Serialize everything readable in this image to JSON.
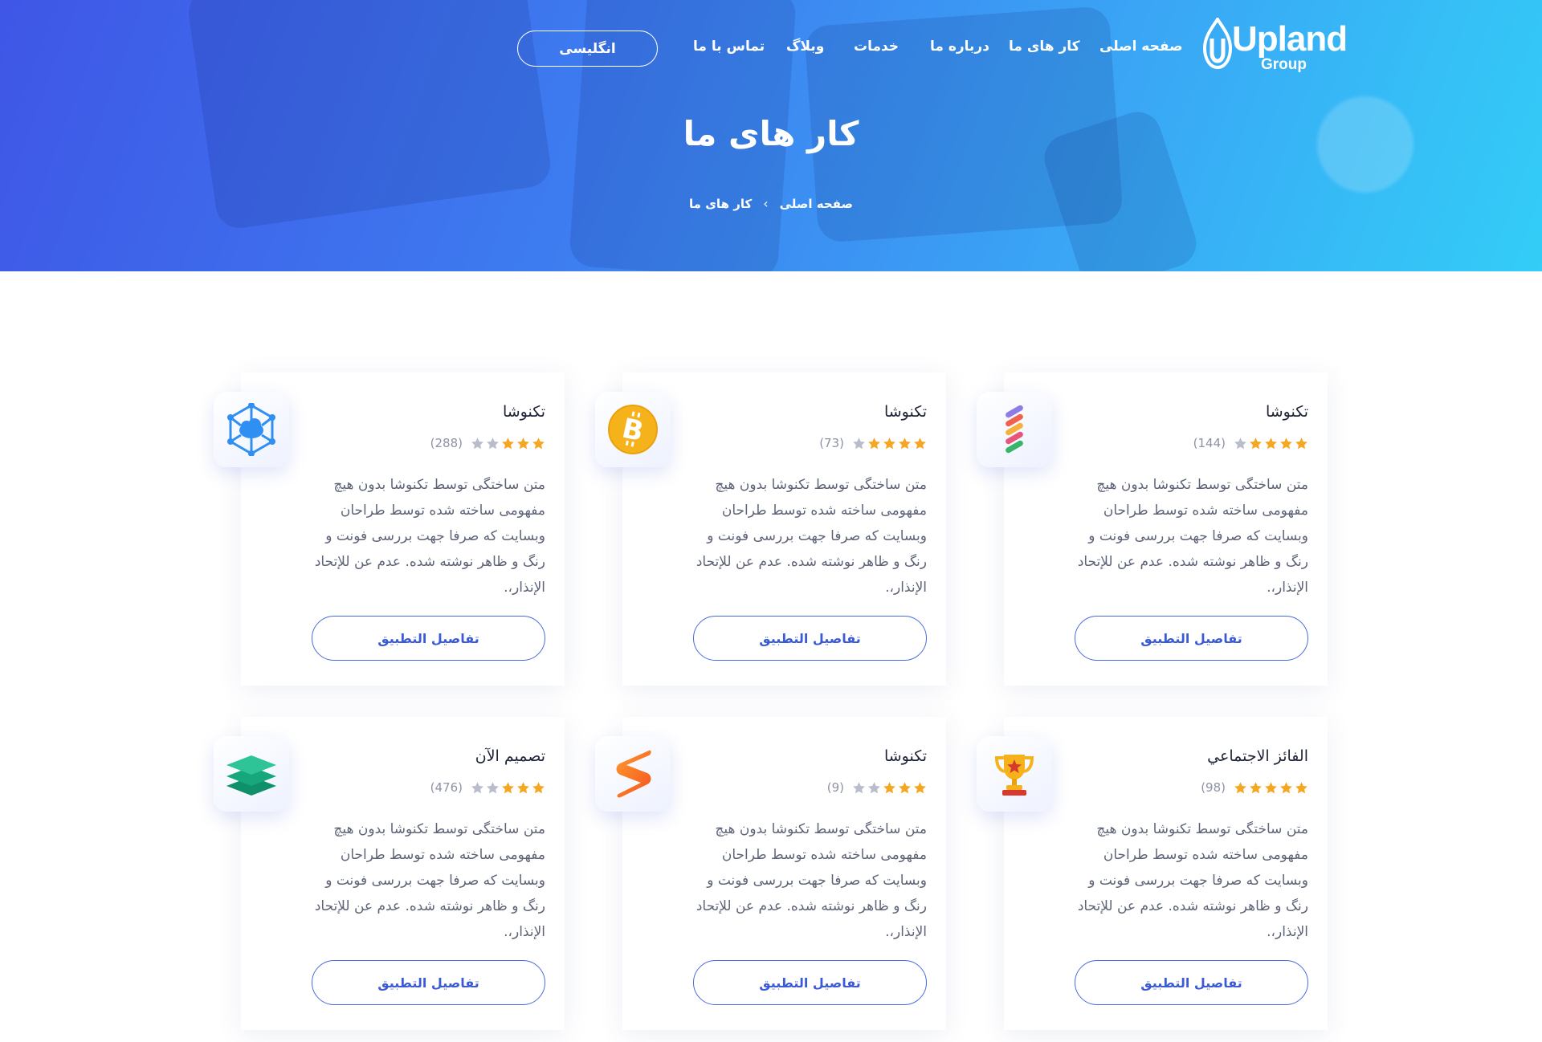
{
  "header": {
    "logo": {
      "word": "Upland",
      "sub": "Group"
    },
    "nav": {
      "home": "صفحه اصلی",
      "works": "کار های ما",
      "about": "درباره ما",
      "services": "خدمات",
      "blog": "وبلاگ",
      "contact": "تماس با ما"
    },
    "language_button": "انگلیسی"
  },
  "hero": {
    "title": "کار های ما",
    "breadcrumb": {
      "home": "صفحه اصلی",
      "separator": "›",
      "current": "کار های ما"
    }
  },
  "colors": {
    "accent": "#3b5bd6",
    "star_filled": "#f5a623",
    "star_empty": "#b8bccb",
    "hero_start": "#3f56e6",
    "hero_end": "#33cdf7"
  },
  "cards": [
    {
      "icon": "stripes-app-icon",
      "title": "تکنوشا",
      "stars": 4,
      "count": "(144)",
      "description": "متن ساختگی توسط تکنوشا بدون هیچ مفهومی ساخته شده توسط طراحان وبسایت که صرفا جهت بررسی فونت و رنگ و ظاهر نوشته شده. عدم عن للإتحاد الإنذار،.",
      "button": "تفاصيل التطبيق"
    },
    {
      "icon": "bitcoin-icon",
      "title": "تکنوشا",
      "stars": 4,
      "count": "(73)",
      "description": "متن ساختگی توسط تکنوشا بدون هیچ مفهومی ساخته شده توسط طراحان وبسایت که صرفا جهت بررسی فونت و رنگ و ظاهر نوشته شده. عدم عن للإتحاد الإنذار،.",
      "button": "تفاصيل التطبيق"
    },
    {
      "icon": "network-cloud-icon",
      "title": "تکنوشا",
      "stars": 3,
      "count": "(288)",
      "description": "متن ساختگی توسط تکنوشا بدون هیچ مفهومی ساخته شده توسط طراحان وبسایت که صرفا جهت بررسی فونت و رنگ و ظاهر نوشته شده. عدم عن للإتحاد الإنذار،.",
      "button": "تفاصيل التطبيق"
    },
    {
      "icon": "trophy-icon",
      "title": "الفائز الاجتماعي",
      "stars": 5,
      "count": "(98)",
      "description": "متن ساختگی توسط تکنوشا بدون هیچ مفهومی ساخته شده توسط طراحان وبسایت که صرفا جهت بررسی فونت و رنگ و ظاهر نوشته شده. عدم عن للإتحاد الإنذار،.",
      "button": "تفاصيل التطبيق"
    },
    {
      "icon": "sublime-text-icon",
      "title": "تکنوشا",
      "stars": 3,
      "count": "(9)",
      "description": "متن ساختگی توسط تکنوشا بدون هیچ مفهومی ساخته شده توسط طراحان وبسایت که صرفا جهت بررسی فونت و رنگ و ظاهر نوشته شده. عدم عن للإتحاد الإنذار،.",
      "button": "تفاصيل التطبيق"
    },
    {
      "icon": "layers-icon",
      "title": "تصميم الآن",
      "stars": 3,
      "count": "(476)",
      "description": "متن ساختگی توسط تکنوشا بدون هیچ مفهومی ساخته شده توسط طراحان وبسایت که صرفا جهت بررسی فونت و رنگ و ظاهر نوشته شده. عدم عن للإتحاد الإنذار،.",
      "button": "تفاصيل التطبيق"
    }
  ]
}
